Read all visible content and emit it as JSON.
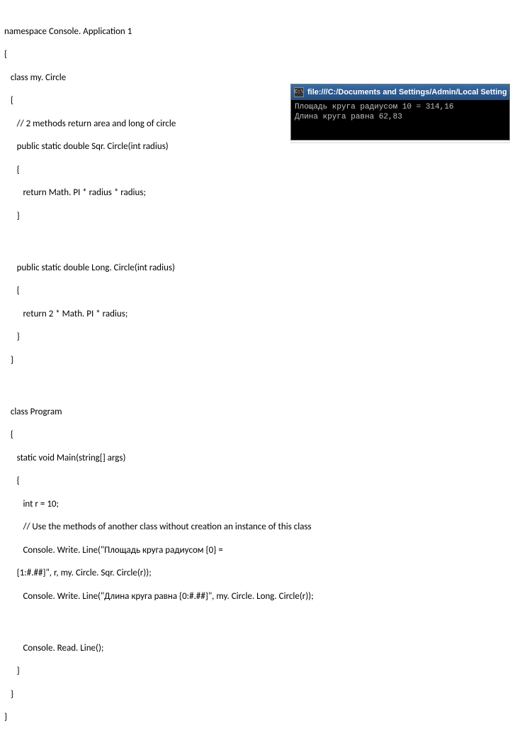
{
  "code": {
    "l1": "namespace Console. Application 1",
    "l2": "{",
    "l3": "   class my. Circle",
    "l4": "   {",
    "l5": "      // 2 methods return area and long of circle",
    "l6": "      public static double Sqr. Circle(int radius)",
    "l7": "      {",
    "l8": "         return Math. PI * radius * radius;",
    "l9": "      }",
    "l10": "      public static double Long. Circle(int radius)",
    "l11": "      {",
    "l12": "         return 2 * Math. PI * radius;",
    "l13": "      }",
    "l14": "   }",
    "l15": "   class Program",
    "l16": "   {",
    "l17": "      static void Main(string[] args)",
    "l18": "      {",
    "l19": "         int r = 10;",
    "l20": "         // Use the methods of another class without creation an instance of this class",
    "l21": "         Console. Write. Line(\"Площадь круга радиусом {0} =",
    "l22": "      {1:#.##}\", r, my. Circle. Sqr. Circle(r));",
    "l23": "         Console. Write. Line(\"Длина круга равна {0:#.##}\", my. Circle. Long. Circle(r));",
    "l24": "         Console. Read. Line();",
    "l25": "      }",
    "l26": "   }",
    "l27": "}"
  },
  "console": {
    "icon_label": "C:\\",
    "title": "file:///C:/Documents and Settings/Admin/Local Settings/Applica",
    "line1": "Площадь круга радиусом 10 = 314,16",
    "line2": "Длина круга равна 62,83"
  }
}
